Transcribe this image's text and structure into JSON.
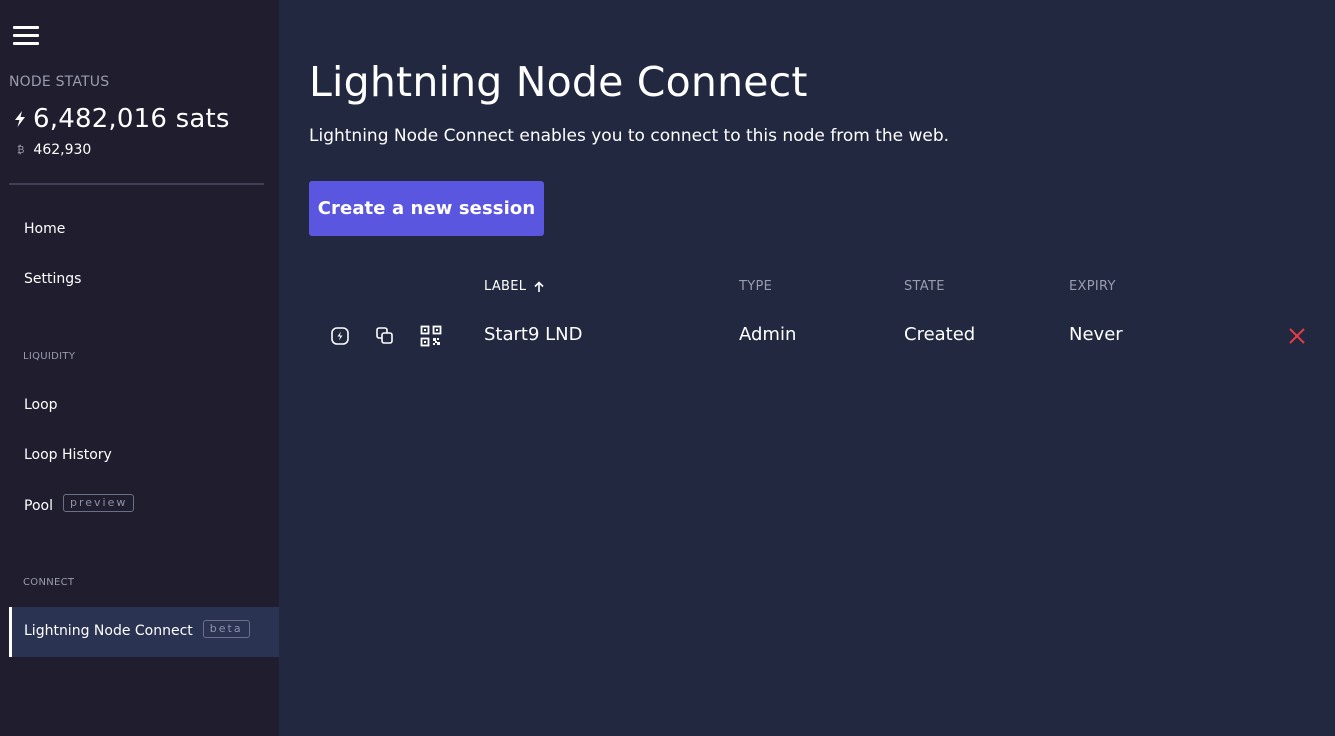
{
  "sidebar": {
    "node_status_label": "NODE STATUS",
    "balance_sats": "6,482,016 sats",
    "balance_btc_alt": "462,930",
    "btc_symbol": "₿",
    "nav": {
      "home": "Home",
      "settings": "Settings",
      "liquidity_section": "LIQUIDITY",
      "loop": "Loop",
      "loop_history": "Loop History",
      "pool": "Pool",
      "pool_badge": "preview",
      "connect_section": "CONNECT",
      "lnc": "Lightning Node Connect",
      "lnc_badge": "beta"
    }
  },
  "main": {
    "title": "Lightning Node Connect",
    "description": "Lightning Node Connect enables you to connect to this node from the web.",
    "create_button": "Create a new session",
    "table": {
      "columns": {
        "label": "LABEL",
        "type": "TYPE",
        "state": "STATE",
        "expiry": "EXPIRY"
      },
      "rows": [
        {
          "label": "Start9 LND",
          "type": "Admin",
          "state": "Created",
          "expiry": "Never"
        }
      ]
    }
  },
  "colors": {
    "accent": "#5a56e0",
    "danger": "#e63c46",
    "sidebar_bg": "#1f1d2e",
    "main_bg": "#222840"
  },
  "icons": [
    "menu-icon",
    "bolt-icon",
    "bitcoin-icon",
    "sort-ascending-icon",
    "open-terminal-icon",
    "copy-icon",
    "qr-code-icon",
    "close-icon"
  ]
}
